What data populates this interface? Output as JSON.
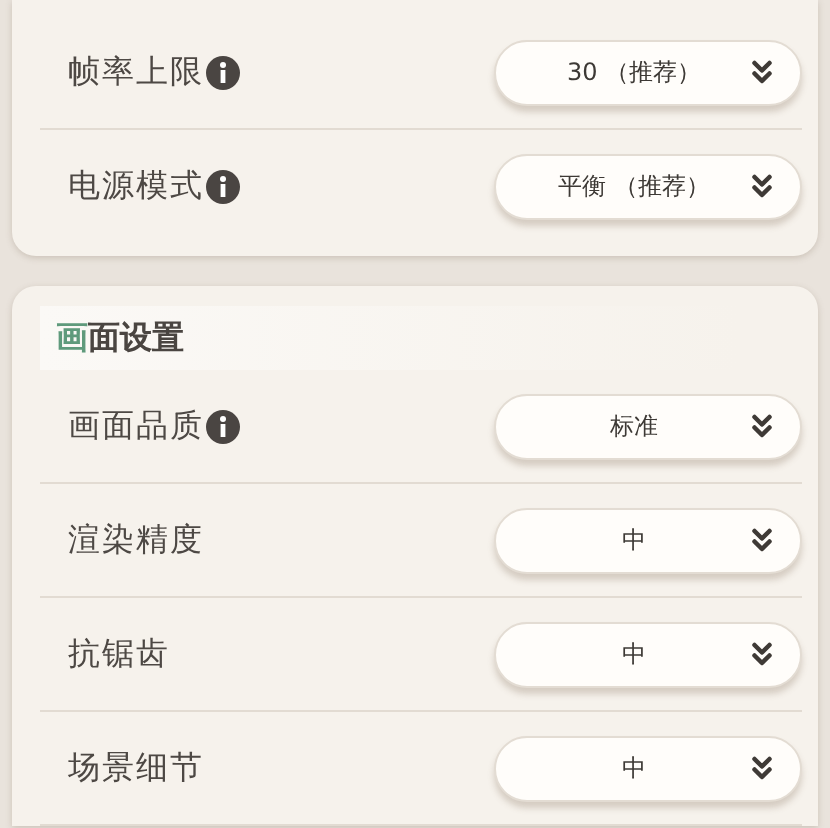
{
  "sections": [
    {
      "rows": [
        {
          "label": "帧率上限",
          "info": true,
          "value": "30 （推荐）"
        },
        {
          "label": "电源模式",
          "info": true,
          "value": "平衡 （推荐）"
        }
      ]
    },
    {
      "header": {
        "accent": "画",
        "rest": "面设置"
      },
      "rows": [
        {
          "label": "画面品质",
          "info": true,
          "value": "标准"
        },
        {
          "label": "渲染精度",
          "info": false,
          "value": "中"
        },
        {
          "label": "抗锯齿",
          "info": false,
          "value": "中"
        },
        {
          "label": "场景细节",
          "info": false,
          "value": "中"
        }
      ]
    }
  ]
}
